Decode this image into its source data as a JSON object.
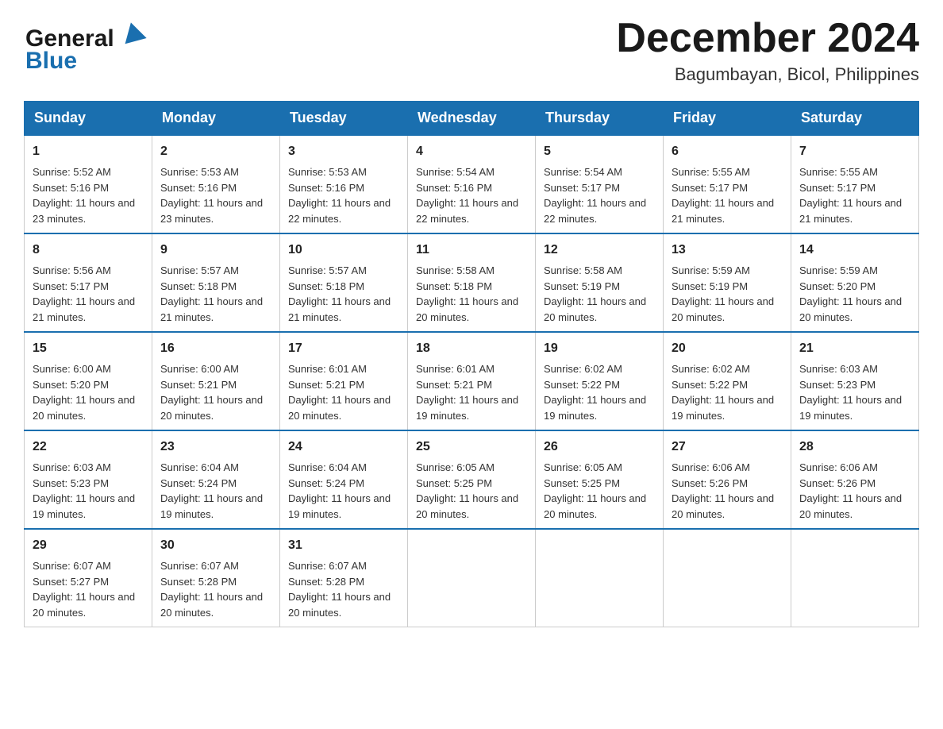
{
  "header": {
    "logo_text_general": "General",
    "logo_text_blue": "Blue",
    "month_title": "December 2024",
    "location": "Bagumbayan, Bicol, Philippines"
  },
  "days_of_week": [
    "Sunday",
    "Monday",
    "Tuesday",
    "Wednesday",
    "Thursday",
    "Friday",
    "Saturday"
  ],
  "weeks": [
    [
      {
        "day": "1",
        "sunrise": "5:52 AM",
        "sunset": "5:16 PM",
        "daylight": "11 hours and 23 minutes."
      },
      {
        "day": "2",
        "sunrise": "5:53 AM",
        "sunset": "5:16 PM",
        "daylight": "11 hours and 23 minutes."
      },
      {
        "day": "3",
        "sunrise": "5:53 AM",
        "sunset": "5:16 PM",
        "daylight": "11 hours and 22 minutes."
      },
      {
        "day": "4",
        "sunrise": "5:54 AM",
        "sunset": "5:16 PM",
        "daylight": "11 hours and 22 minutes."
      },
      {
        "day": "5",
        "sunrise": "5:54 AM",
        "sunset": "5:17 PM",
        "daylight": "11 hours and 22 minutes."
      },
      {
        "day": "6",
        "sunrise": "5:55 AM",
        "sunset": "5:17 PM",
        "daylight": "11 hours and 21 minutes."
      },
      {
        "day": "7",
        "sunrise": "5:55 AM",
        "sunset": "5:17 PM",
        "daylight": "11 hours and 21 minutes."
      }
    ],
    [
      {
        "day": "8",
        "sunrise": "5:56 AM",
        "sunset": "5:17 PM",
        "daylight": "11 hours and 21 minutes."
      },
      {
        "day": "9",
        "sunrise": "5:57 AM",
        "sunset": "5:18 PM",
        "daylight": "11 hours and 21 minutes."
      },
      {
        "day": "10",
        "sunrise": "5:57 AM",
        "sunset": "5:18 PM",
        "daylight": "11 hours and 21 minutes."
      },
      {
        "day": "11",
        "sunrise": "5:58 AM",
        "sunset": "5:18 PM",
        "daylight": "11 hours and 20 minutes."
      },
      {
        "day": "12",
        "sunrise": "5:58 AM",
        "sunset": "5:19 PM",
        "daylight": "11 hours and 20 minutes."
      },
      {
        "day": "13",
        "sunrise": "5:59 AM",
        "sunset": "5:19 PM",
        "daylight": "11 hours and 20 minutes."
      },
      {
        "day": "14",
        "sunrise": "5:59 AM",
        "sunset": "5:20 PM",
        "daylight": "11 hours and 20 minutes."
      }
    ],
    [
      {
        "day": "15",
        "sunrise": "6:00 AM",
        "sunset": "5:20 PM",
        "daylight": "11 hours and 20 minutes."
      },
      {
        "day": "16",
        "sunrise": "6:00 AM",
        "sunset": "5:21 PM",
        "daylight": "11 hours and 20 minutes."
      },
      {
        "day": "17",
        "sunrise": "6:01 AM",
        "sunset": "5:21 PM",
        "daylight": "11 hours and 20 minutes."
      },
      {
        "day": "18",
        "sunrise": "6:01 AM",
        "sunset": "5:21 PM",
        "daylight": "11 hours and 19 minutes."
      },
      {
        "day": "19",
        "sunrise": "6:02 AM",
        "sunset": "5:22 PM",
        "daylight": "11 hours and 19 minutes."
      },
      {
        "day": "20",
        "sunrise": "6:02 AM",
        "sunset": "5:22 PM",
        "daylight": "11 hours and 19 minutes."
      },
      {
        "day": "21",
        "sunrise": "6:03 AM",
        "sunset": "5:23 PM",
        "daylight": "11 hours and 19 minutes."
      }
    ],
    [
      {
        "day": "22",
        "sunrise": "6:03 AM",
        "sunset": "5:23 PM",
        "daylight": "11 hours and 19 minutes."
      },
      {
        "day": "23",
        "sunrise": "6:04 AM",
        "sunset": "5:24 PM",
        "daylight": "11 hours and 19 minutes."
      },
      {
        "day": "24",
        "sunrise": "6:04 AM",
        "sunset": "5:24 PM",
        "daylight": "11 hours and 19 minutes."
      },
      {
        "day": "25",
        "sunrise": "6:05 AM",
        "sunset": "5:25 PM",
        "daylight": "11 hours and 20 minutes."
      },
      {
        "day": "26",
        "sunrise": "6:05 AM",
        "sunset": "5:25 PM",
        "daylight": "11 hours and 20 minutes."
      },
      {
        "day": "27",
        "sunrise": "6:06 AM",
        "sunset": "5:26 PM",
        "daylight": "11 hours and 20 minutes."
      },
      {
        "day": "28",
        "sunrise": "6:06 AM",
        "sunset": "5:26 PM",
        "daylight": "11 hours and 20 minutes."
      }
    ],
    [
      {
        "day": "29",
        "sunrise": "6:07 AM",
        "sunset": "5:27 PM",
        "daylight": "11 hours and 20 minutes."
      },
      {
        "day": "30",
        "sunrise": "6:07 AM",
        "sunset": "5:28 PM",
        "daylight": "11 hours and 20 minutes."
      },
      {
        "day": "31",
        "sunrise": "6:07 AM",
        "sunset": "5:28 PM",
        "daylight": "11 hours and 20 minutes."
      },
      null,
      null,
      null,
      null
    ]
  ]
}
